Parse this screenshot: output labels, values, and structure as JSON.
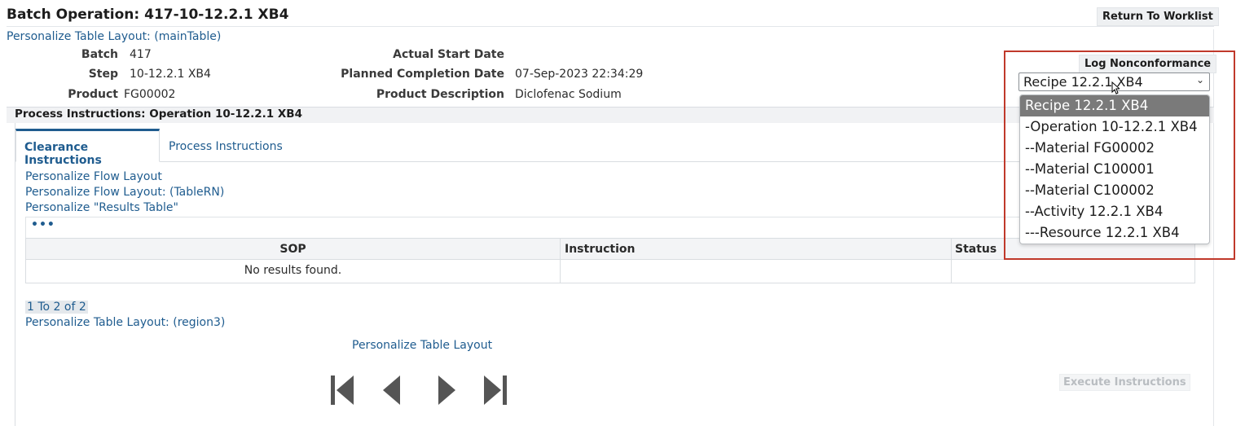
{
  "header": {
    "title": "Batch Operation: 417-10-12.2.1 XB4",
    "return_button": "Return To Worklist",
    "personalize_main": "Personalize Table Layout: (mainTable)"
  },
  "details": {
    "batch_label": "Batch",
    "batch_value": "417",
    "step_label": "Step",
    "step_value": "10-12.2.1 XB4",
    "product_label": "Product",
    "product_value": "FG00002",
    "actual_start_label": "Actual Start Date",
    "actual_start_value": "",
    "planned_completion_label": "Planned Completion Date",
    "planned_completion_value": "07-Sep-2023 22:34:29",
    "product_desc_label": "Product Description",
    "product_desc_value": "Diclofenac Sodium"
  },
  "nonconformance": {
    "button": "Log Nonconformance",
    "selected": "Recipe 12.2.1 XB4",
    "options": [
      "Recipe 12.2.1 XB4",
      "-Operation 10-12.2.1 XB4",
      "--Material FG00002",
      "--Material C100001",
      "--Material C100002",
      "--Activity 12.2.1 XB4",
      "---Resource 12.2.1 XB4"
    ]
  },
  "section": {
    "title": "Process Instructions: Operation 10-12.2.1 XB4"
  },
  "tabs": [
    {
      "label": "Clearance Instructions",
      "active": true
    },
    {
      "label": "Process Instructions",
      "active": false
    }
  ],
  "personalize_links": {
    "flow_layout": "Personalize Flow Layout",
    "flow_layout_table": "Personalize Flow Layout: (TableRN)",
    "results_table": "Personalize \"Results Table\"",
    "table_region3": "Personalize Table Layout: (region3)",
    "table_layout": "Personalize Table Layout"
  },
  "results_table": {
    "toolbar_label": "•••",
    "columns": [
      "SOP",
      "Instruction",
      "Status"
    ],
    "empty_message": "No results found."
  },
  "pagination": {
    "range": "1 To 2 of 2"
  },
  "execute_button": "Execute Instructions",
  "colors": {
    "link": "#1f5c8f",
    "highlight": "#c0392b",
    "selected_option": "#7a7a7a"
  }
}
